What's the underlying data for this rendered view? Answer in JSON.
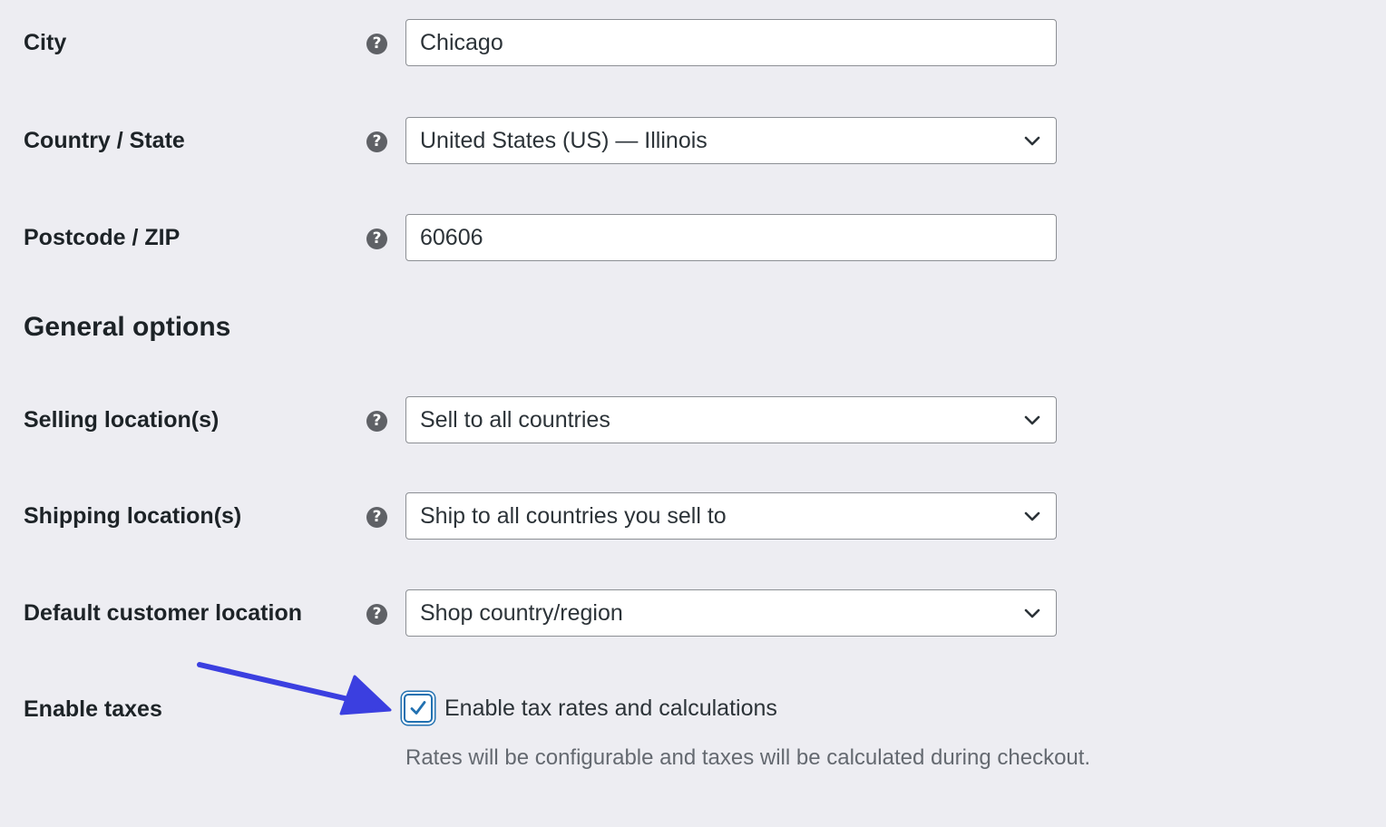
{
  "accent_color": "#2271b1",
  "annotation_arrow_color": "#3b3fe0",
  "store_address": {
    "city": {
      "label": "City",
      "value": "Chicago",
      "help_icon": "question-circle-icon"
    },
    "country_state": {
      "label": "Country / State",
      "value": "United States (US) — Illinois",
      "help_icon": "question-circle-icon"
    },
    "postcode": {
      "label": "Postcode / ZIP",
      "value": "60606",
      "help_icon": "question-circle-icon"
    }
  },
  "general_options": {
    "title": "General options",
    "selling_locations": {
      "label": "Selling location(s)",
      "value": "Sell to all countries"
    },
    "shipping_locations": {
      "label": "Shipping location(s)",
      "value": "Ship to all countries you sell to"
    },
    "default_customer_location": {
      "label": "Default customer location",
      "value": "Shop country/region"
    },
    "enable_taxes": {
      "label": "Enable taxes",
      "checkbox_label": "Enable tax rates and calculations",
      "checked": true,
      "description": "Rates will be configurable and taxes will be calculated during checkout."
    }
  },
  "help_glyph": "?"
}
